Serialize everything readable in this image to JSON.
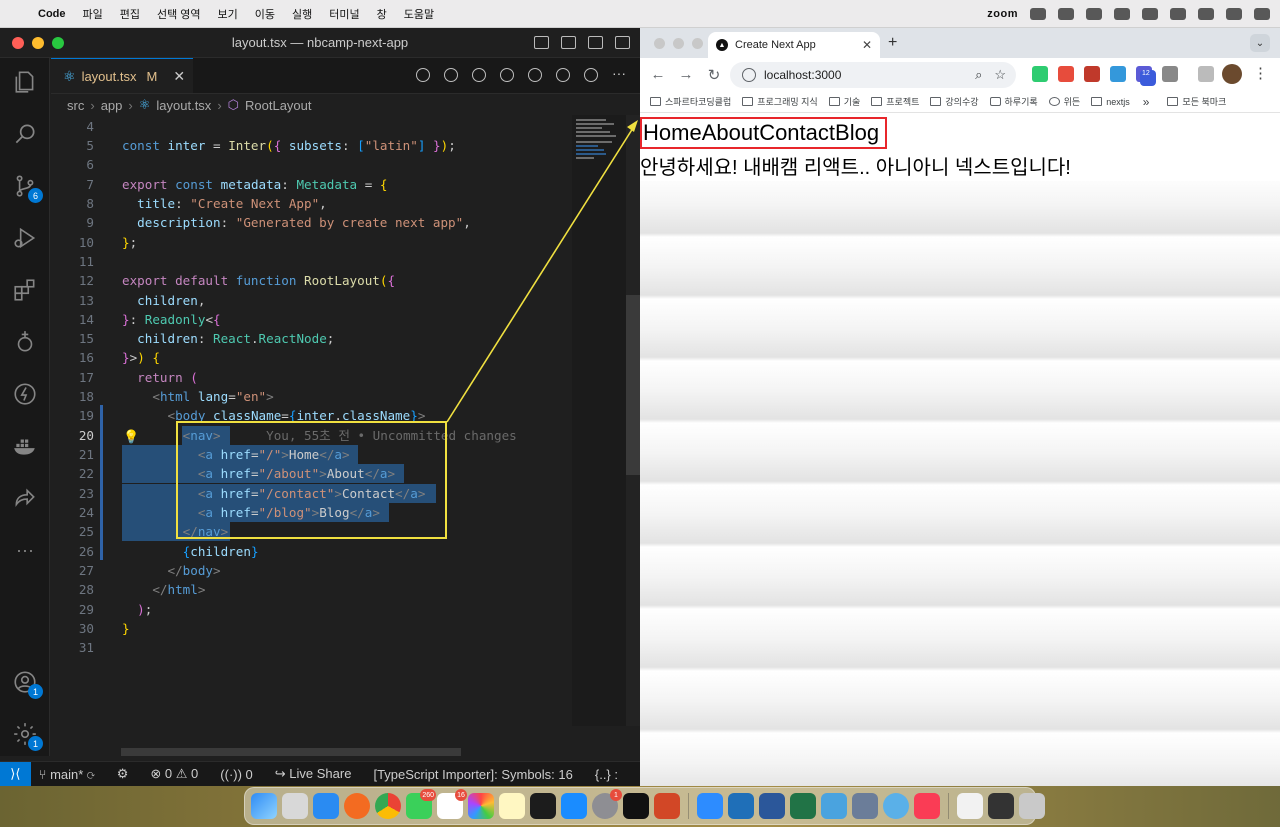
{
  "menubar": {
    "app_name": "Code",
    "items": [
      "파일",
      "편집",
      "선택 영역",
      "보기",
      "이동",
      "실행",
      "터미널",
      "창",
      "도움말"
    ],
    "zoom_label": "zoom"
  },
  "vscode": {
    "window_title": "layout.tsx — nbcamp-next-app",
    "tab": {
      "filename": "layout.tsx",
      "modified": "M"
    },
    "breadcrumb": [
      "src",
      "app",
      "layout.tsx",
      "RootLayout"
    ],
    "badges": {
      "source_control": "6",
      "accounts": "1",
      "settings": "1"
    },
    "blame": "You, 55초 전 • Uncommitted changes",
    "status": {
      "branch": "main*",
      "problems": "0",
      "warnings": "0",
      "ports": "0",
      "live_share": "Live Share",
      "ts_importer": "[TypeScript Importer]: Symbols: 16",
      "braces": "{..} :"
    },
    "line_numbers": [
      "4",
      "5",
      "6",
      "7",
      "8",
      "9",
      "10",
      "11",
      "12",
      "13",
      "14",
      "15",
      "16",
      "17",
      "18",
      "19",
      "20",
      "21",
      "22",
      "23",
      "24",
      "25",
      "26",
      "27",
      "28",
      "29",
      "30",
      "31"
    ],
    "current_line": "20"
  },
  "chrome": {
    "tab_title": "Create Next App",
    "url": "localhost:3000",
    "bookmarks": [
      "스파르타코딩클럽",
      "프로그래밍 지식",
      "기술",
      "프로젝트",
      "강의수강",
      "하루기록",
      "위든",
      "nextjs"
    ],
    "all_bookmarks": "모든 북마크",
    "ext_badge": "12"
  },
  "page": {
    "nav_links": [
      "Home",
      "About",
      "Contact",
      "Blog"
    ],
    "greeting": "안녕하세요! 내배캠 리액트.. 아니아니 넥스트입니다!"
  },
  "dock": {
    "badges": {
      "messages": "260",
      "slack": "16",
      "settings": "1"
    }
  },
  "colors": {
    "vscode_bg": "#1f1f1f",
    "accent_blue": "#0078d4",
    "annotation_yellow": "#f0e040",
    "annotation_red": "#e8262b"
  }
}
